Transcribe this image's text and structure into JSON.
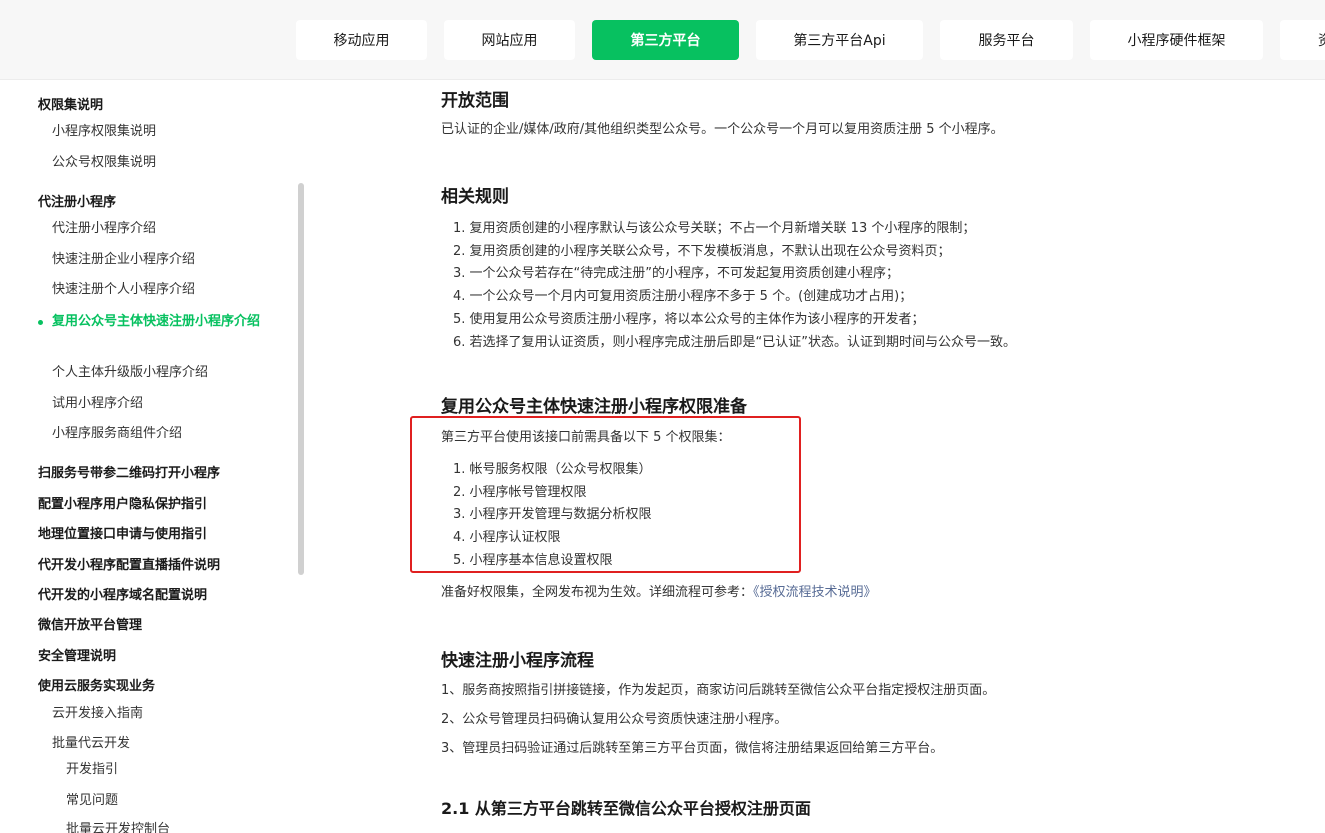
{
  "topbar": {
    "tabs": [
      {
        "label": "移动应用",
        "active": false
      },
      {
        "label": "网站应用",
        "active": false
      },
      {
        "label": "第三方平台",
        "active": true
      },
      {
        "label": "第三方平台Api",
        "active": false
      },
      {
        "label": "服务平台",
        "active": false
      },
      {
        "label": "小程序硬件框架",
        "active": false
      },
      {
        "label": "资",
        "active": false
      }
    ]
  },
  "sidebar": {
    "items": [
      {
        "label": "权限集说明",
        "type": "group"
      },
      {
        "label": "小程序权限集说明",
        "type": "sub"
      },
      {
        "label": "公众号权限集说明",
        "type": "sub"
      },
      {
        "label": "代注册小程序",
        "type": "group"
      },
      {
        "label": "代注册小程序介绍",
        "type": "sub"
      },
      {
        "label": "快速注册企业小程序介绍",
        "type": "sub"
      },
      {
        "label": "快速注册个人小程序介绍",
        "type": "sub"
      },
      {
        "label": "复用公众号主体快速注册小程序介绍",
        "type": "active"
      },
      {
        "label": "个人主体升级版小程序介绍",
        "type": "sub"
      },
      {
        "label": "试用小程序介绍",
        "type": "sub"
      },
      {
        "label": "小程序服务商组件介绍",
        "type": "sub"
      },
      {
        "label": "扫服务号带参二维码打开小程序",
        "type": "group"
      },
      {
        "label": "配置小程序用户隐私保护指引",
        "type": "group"
      },
      {
        "label": "地理位置接口申请与使用指引",
        "type": "group"
      },
      {
        "label": "代开发小程序配置直播插件说明",
        "type": "group"
      },
      {
        "label": "代开发的小程序域名配置说明",
        "type": "group"
      },
      {
        "label": "微信开放平台管理",
        "type": "group"
      },
      {
        "label": "安全管理说明",
        "type": "group"
      },
      {
        "label": "使用云服务实现业务",
        "type": "group"
      },
      {
        "label": "云开发接入指南",
        "type": "sub"
      },
      {
        "label": "批量代云开发",
        "type": "sub"
      },
      {
        "label": "开发指引",
        "type": "sub2"
      },
      {
        "label": "常见问题",
        "type": "sub2"
      },
      {
        "label": "批量云开发控制台",
        "type": "sub2"
      }
    ]
  },
  "content": {
    "scope": {
      "title": "开放范围",
      "text": "已认证的企业/媒体/政府/其他组织类型公众号。一个公众号一个月可以复用资质注册 5 个小程序。"
    },
    "rules": {
      "title": "相关规则",
      "items": [
        "1. 复用资质创建的小程序默认与该公众号关联；不占一个月新增关联 13 个小程序的限制；",
        "2. 复用资质创建的小程序关联公众号，不下发模板消息，不默认出现在公众号资料页；",
        "3. 一个公众号若存在“待完成注册”的小程序，不可发起复用资质创建小程序；",
        "4. 一个公众号一个月内可复用资质注册小程序不多于 5 个。(创建成功才占用)；",
        "5. 使用复用公众号资质注册小程序，将以本公众号的主体作为该小程序的开发者；",
        "6. 若选择了复用认证资质，则小程序完成注册后即是“已认证”状态。认证到期时间与公众号一致。"
      ]
    },
    "permissions": {
      "title": "复用公众号主体快速注册小程序权限准备",
      "intro": "第三方平台使用该接口前需具备以下 5 个权限集：",
      "items": [
        "1. 帐号服务权限（公众号权限集）",
        "2. 小程序帐号管理权限",
        "3. 小程序开发管理与数据分析权限",
        "4. 小程序认证权限",
        "5. 小程序基本信息设置权限"
      ],
      "note_prefix": "准备好权限集，全网发布视为生效。详细流程可参考：",
      "note_link": "《授权流程技术说明》"
    },
    "flow": {
      "title": "快速注册小程序流程",
      "steps": [
        "1、服务商按照指引拼接链接，作为发起页，商家访问后跳转至微信公众平台指定授权注册页面。",
        "2、公众号管理员扫码确认复用公众号资质快速注册小程序。",
        "3、管理员扫码验证通过后跳转至第三方平台页面，微信将注册结果返回给第三方平台。"
      ]
    },
    "section21": {
      "title": "2.1 从第三方平台跳转至微信公众平台授权注册页面"
    }
  },
  "colors": {
    "accent": "#07c160",
    "link": "#576b95",
    "highlight_border": "#e02020"
  }
}
